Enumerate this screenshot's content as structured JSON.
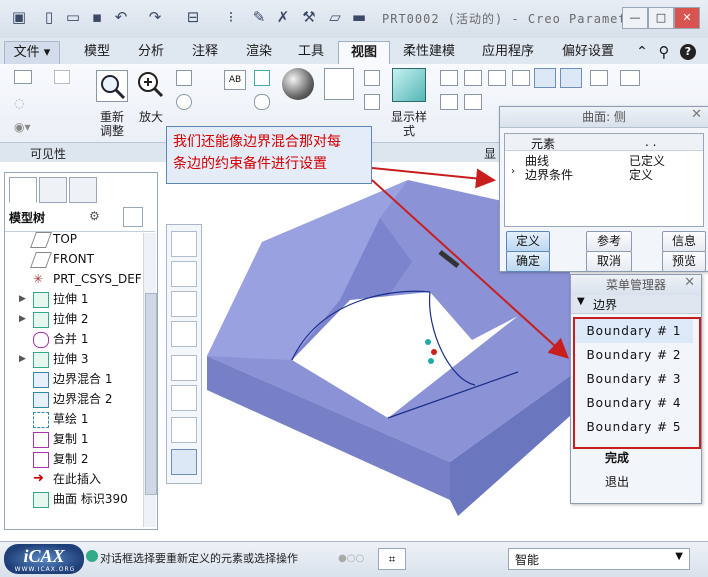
{
  "window": {
    "title": "PRT0002 (活动的) - Creo Paramet..."
  },
  "tabs": [
    {
      "label": "文件 ▾"
    },
    {
      "label": "模型"
    },
    {
      "label": "分析"
    },
    {
      "label": "注释"
    },
    {
      "label": "渲染"
    },
    {
      "label": "工具"
    },
    {
      "label": "视图"
    },
    {
      "label": "柔性建模"
    },
    {
      "label": "应用程序"
    },
    {
      "label": "偏好设置"
    }
  ],
  "ribbon": {
    "reorient_label_1": "重新",
    "reorient_label_2": "调整",
    "zoom_label": "放大",
    "display_style_label_1": "显示样",
    "display_style_label_2": "式",
    "group_visibility": "可见性",
    "group_display_cut": "显"
  },
  "left_panel": {
    "tree_header": "模型树",
    "items": [
      {
        "label": "TOP"
      },
      {
        "label": "FRONT"
      },
      {
        "label": "PRT_CSYS_DEF"
      },
      {
        "label": "拉伸 1"
      },
      {
        "label": "拉伸 2"
      },
      {
        "label": "合并 1"
      },
      {
        "label": "拉伸 3"
      },
      {
        "label": "边界混合 1"
      },
      {
        "label": "边界混合 2"
      },
      {
        "label": "草绘 1"
      },
      {
        "label": "复制 1"
      },
      {
        "label": "复制 2"
      },
      {
        "label": "在此插入"
      },
      {
        "label": "曲面 标识390"
      }
    ]
  },
  "callout": {
    "text_line1": "我们还能像边界混合那对每",
    "text_line2": "条边的约束备件进行设置"
  },
  "surface_dialog": {
    "title": "曲面: 侧",
    "col_element": "元素",
    "col_info": ". .",
    "rows": [
      {
        "element": "曲线",
        "status": "已定义"
      },
      {
        "element": "边界条件",
        "status": "定义"
      }
    ],
    "btn_define": "定义",
    "btn_reference": "参考",
    "btn_info": "信息",
    "btn_ok": "确定",
    "btn_cancel": "取消",
    "btn_preview": "预览"
  },
  "menu_manager": {
    "title": "菜单管理器",
    "section": "边界",
    "items": [
      {
        "label": "Boundary # 1"
      },
      {
        "label": "Boundary # 2"
      },
      {
        "label": "Boundary # 3"
      },
      {
        "label": "Boundary # 4"
      },
      {
        "label": "Boundary # 5"
      }
    ],
    "done": "完成",
    "quit": "退出"
  },
  "statusbar": {
    "message": "对话框选择要重新定义的元素或选择操作",
    "filter_value": "智能",
    "logo_text": "iCAX",
    "logo_url": "WWW.ICAX.ORG"
  },
  "colors": {
    "model_face": "#7a86c9",
    "model_top": "#8b93d6",
    "model_side": "#6a76bd",
    "callout_text": "#d40000",
    "highlight_box": "#c81e1e"
  }
}
